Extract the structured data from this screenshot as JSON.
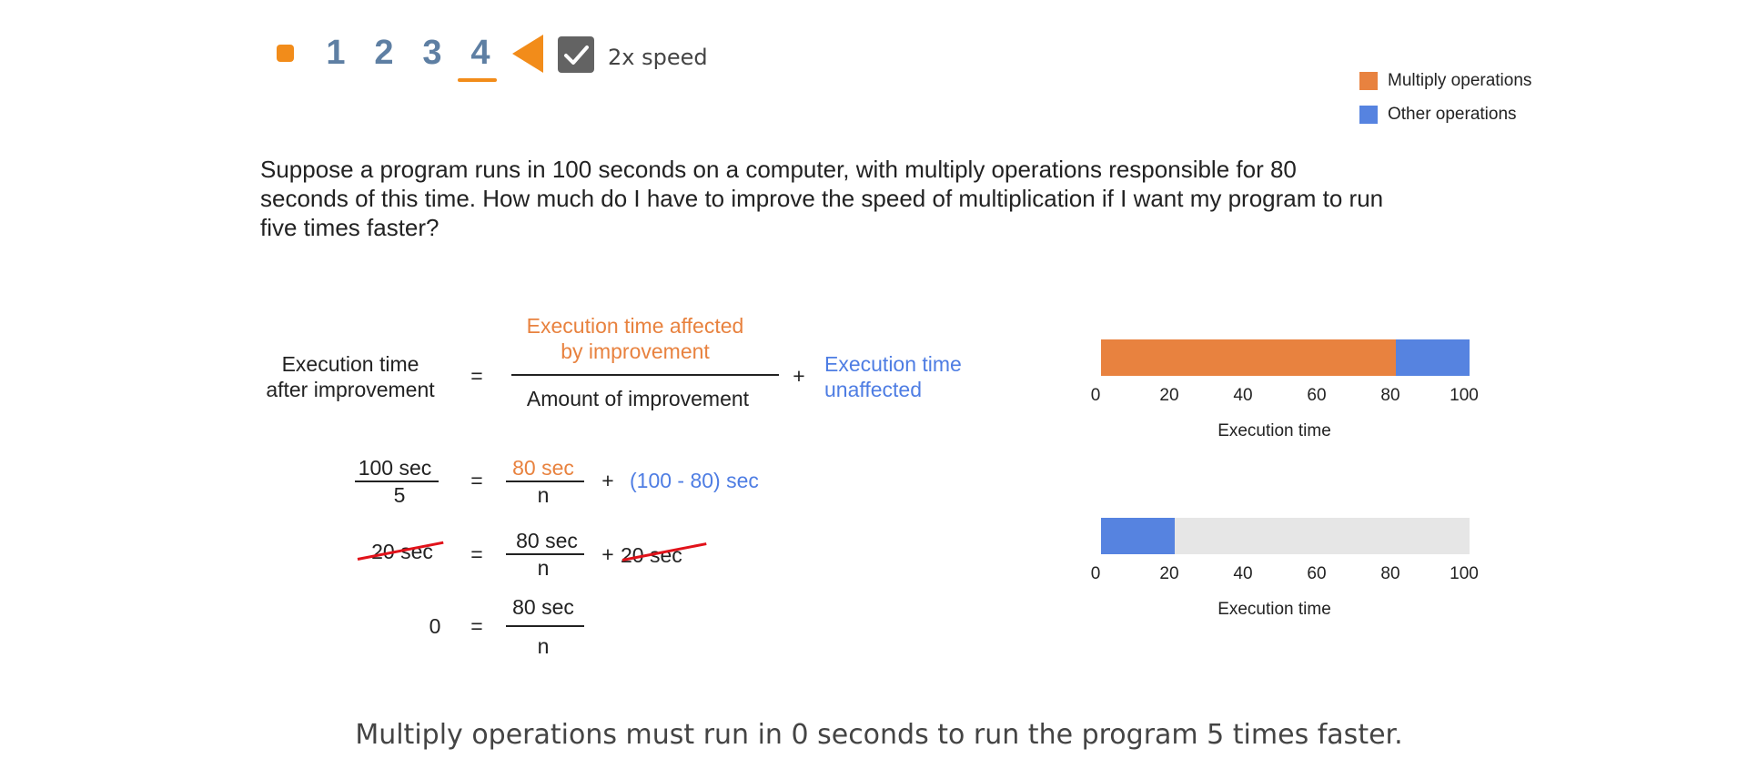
{
  "controls": {
    "steps": [
      "1",
      "2",
      "3",
      "4"
    ],
    "active_step": "4",
    "speed_checked": true,
    "speed_label": "2x speed",
    "accent_color": "#f28c1a"
  },
  "legend": {
    "multiply": "Multiply operations",
    "other": "Other operations"
  },
  "question": "Suppose a program runs in 100 seconds on a computer, with multiply operations responsible for 80 seconds of this time. How much do I have to improve the speed of multiplication if I want my program to run five times faster?",
  "formula": {
    "lhs_line1": "Execution time",
    "lhs_line2": "after improvement",
    "equals": "=",
    "num_line1": "Execution time affected",
    "num_line2": "by improvement",
    "denominator": "Amount of improvement",
    "plus": "+",
    "rhs_line1": "Execution time",
    "rhs_line2": "unaffected"
  },
  "step1": {
    "lhs_num": "100 sec",
    "lhs_den": "5",
    "equals": "=",
    "num": "80 sec",
    "den": "n",
    "plus": "+",
    "rhs": "(100 - 80) sec"
  },
  "step2": {
    "lhs": "20 sec",
    "equals": "=",
    "num": "80 sec",
    "den": "n",
    "plus": "+",
    "rhs": "20 sec"
  },
  "step3": {
    "lhs": "0",
    "equals": "=",
    "num": "80 sec",
    "den": "n"
  },
  "colors": {
    "multiply": "#e8823f",
    "other": "#5683e0",
    "remaining": "#e6e6e6"
  },
  "chart_data": [
    {
      "type": "bar",
      "orientation": "horizontal",
      "stacked": true,
      "series": [
        {
          "name": "Multiply operations",
          "values": [
            80
          ]
        },
        {
          "name": "Other operations",
          "values": [
            20
          ]
        }
      ],
      "xlabel": "Execution time",
      "xlim": [
        0,
        100
      ],
      "ticks": [
        "0",
        "20",
        "40",
        "60",
        "80",
        "100"
      ]
    },
    {
      "type": "bar",
      "orientation": "horizontal",
      "stacked": true,
      "series": [
        {
          "name": "Other operations",
          "values": [
            20
          ]
        }
      ],
      "xlabel": "Execution time",
      "xlim": [
        0,
        100
      ],
      "ticks": [
        "0",
        "20",
        "40",
        "60",
        "80",
        "100"
      ]
    }
  ],
  "conclusion": "Multiply operations must run in 0 seconds to run the program 5 times faster."
}
